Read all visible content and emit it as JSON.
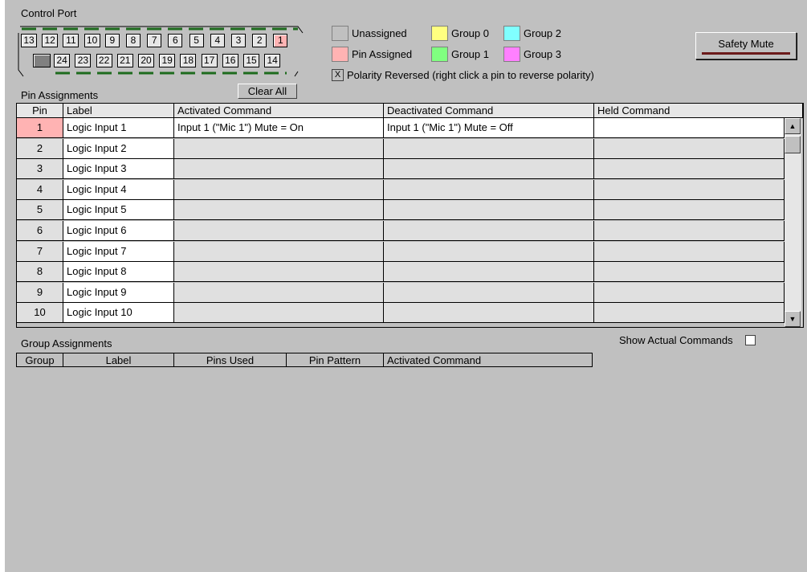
{
  "control_port": {
    "title": "Control Port",
    "top_row": [
      "13",
      "12",
      "11",
      "10",
      "9",
      "8",
      "7",
      "6",
      "5",
      "4",
      "3",
      "2",
      "1"
    ],
    "bottom_row": [
      "",
      "24",
      "23",
      "22",
      "21",
      "20",
      "19",
      "18",
      "17",
      "16",
      "15",
      "14"
    ],
    "clear_all_label": "Clear All"
  },
  "legend": {
    "unassigned": "Unassigned",
    "pin_assigned": "Pin Assigned",
    "group0": "Group 0",
    "group1": "Group 1",
    "group2": "Group 2",
    "group3": "Group 3",
    "polarity_mark": "X",
    "polarity_text": "Polarity Reversed (right click a pin to reverse polarity)",
    "colors": {
      "unassigned": "#c0c0c0",
      "pin_assigned": "#ffb3b3",
      "group0": "#ffff80",
      "group1": "#80ff80",
      "group2": "#80ffff",
      "group3": "#ff80ff"
    }
  },
  "safety_mute_label": "Safety Mute",
  "pin_assignments": {
    "title": "Pin Assignments",
    "columns": [
      "Pin",
      "Label",
      "Activated Command",
      "Deactivated Command",
      "Held Command"
    ],
    "rows": [
      {
        "pin": "1",
        "label": "Logic Input 1",
        "activated": "Input 1 (\"Mic 1\") Mute = On",
        "deactivated": "Input 1 (\"Mic 1\") Mute = Off",
        "held": ""
      },
      {
        "pin": "2",
        "label": "Logic Input 2",
        "activated": "",
        "deactivated": "",
        "held": ""
      },
      {
        "pin": "3",
        "label": "Logic Input 3",
        "activated": "",
        "deactivated": "",
        "held": ""
      },
      {
        "pin": "4",
        "label": "Logic Input 4",
        "activated": "",
        "deactivated": "",
        "held": ""
      },
      {
        "pin": "5",
        "label": "Logic Input 5",
        "activated": "",
        "deactivated": "",
        "held": ""
      },
      {
        "pin": "6",
        "label": "Logic Input 6",
        "activated": "",
        "deactivated": "",
        "held": ""
      },
      {
        "pin": "7",
        "label": "Logic Input 7",
        "activated": "",
        "deactivated": "",
        "held": ""
      },
      {
        "pin": "8",
        "label": "Logic Input 8",
        "activated": "",
        "deactivated": "",
        "held": ""
      },
      {
        "pin": "9",
        "label": "Logic Input 9",
        "activated": "",
        "deactivated": "",
        "held": ""
      },
      {
        "pin": "10",
        "label": "Logic Input 10",
        "activated": "",
        "deactivated": "",
        "held": ""
      }
    ]
  },
  "group_assignments": {
    "title": "Group Assignments",
    "columns": [
      "Group",
      "Label",
      "Pins Used",
      "Pin Pattern",
      "Activated Command"
    ],
    "show_actual_label": "Show Actual Commands"
  }
}
